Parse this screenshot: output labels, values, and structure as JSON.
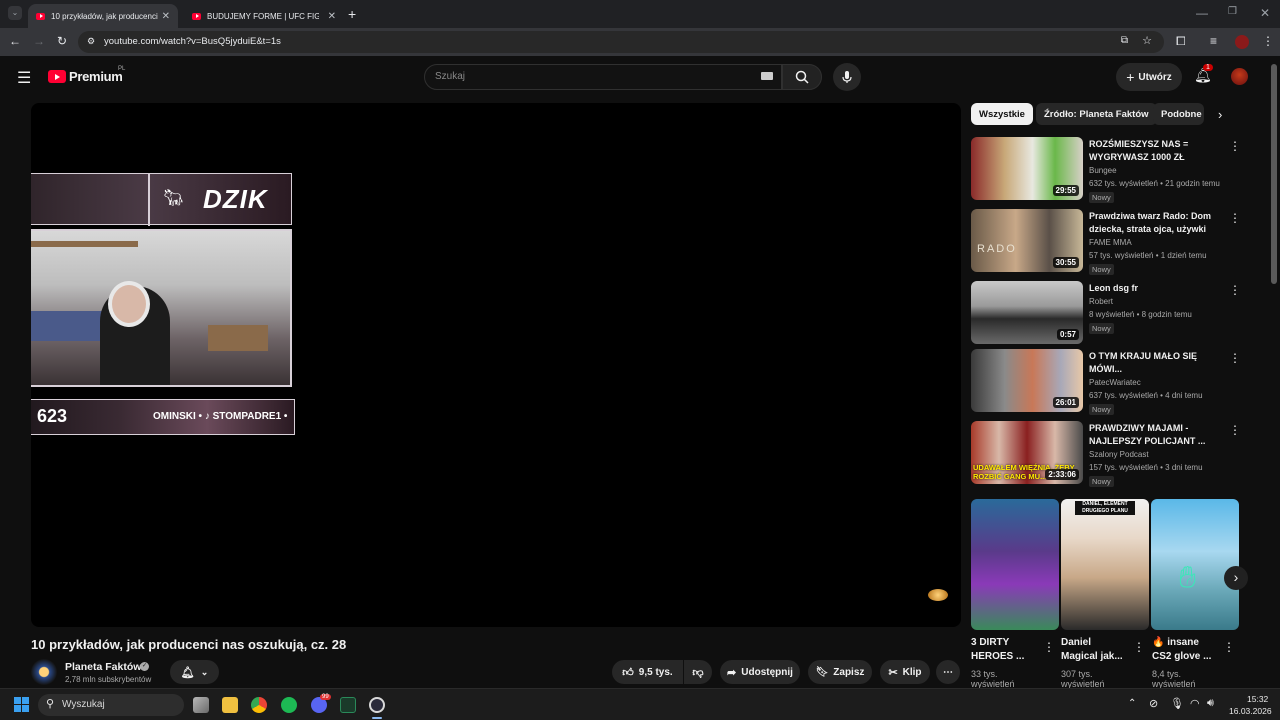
{
  "browser": {
    "tabs": [
      {
        "label": "10 przykładów, jak producenci"
      },
      {
        "label": "BUDUJEMY FORME | UFC FIGHT"
      }
    ],
    "url": "youtube.com/watch?v=BusQ5jyduiE&t=1s"
  },
  "header": {
    "logo": "Premium",
    "logo_badge": "PL",
    "search_placeholder": "Szukaj",
    "create_label": "Utwórz",
    "notif_count": "1"
  },
  "video": {
    "title": "10 przykładów, jak producenci nas oszukują, cz. 28",
    "channel": "Planeta Faktów",
    "subscribers": "2,78 mln subskrybentów",
    "likes": "9,5 tys.",
    "share_label": "Udostępnij",
    "save_label": "Zapisz",
    "clip_label": "Klip"
  },
  "overlay": {
    "brand": "DZIK",
    "counter": "623",
    "ticker": "OMINSKI • ♪ STOMPADRE1 •"
  },
  "chips": [
    "Wszystkie",
    "Źródło: Planeta Faktów",
    "Podobne"
  ],
  "related": [
    {
      "title": "ROZŚMIESZYSZ NAS = WYGRYWASZ 1000 ZŁ",
      "channel": "Bungee",
      "meta": "632 tys. wyświetleń • 21 godzin temu",
      "badge": "Nowy",
      "duration": "29:55"
    },
    {
      "title": "Prawdziwa twarz Rado: Dom dziecka, strata ojca, używki",
      "channel": "FAME MMA",
      "meta": "57 tys. wyświetleń • 1 dzień temu",
      "badge": "Nowy",
      "duration": "30:55"
    },
    {
      "title": "Leon dsg fr",
      "channel": "Robert",
      "meta": "8 wyświetleń • 8 godzin temu",
      "badge": "Nowy",
      "duration": "0:57"
    },
    {
      "title": "O TYM KRAJU MAŁO SIĘ MÓWI...",
      "channel": "PatecWariatec",
      "meta": "637 tys. wyświetleń • 4 dni temu",
      "badge": "Nowy",
      "duration": "26:01"
    },
    {
      "title": "PRAWDZIWY MAJAMI - NAJLEPSZY POLICJANT ...",
      "channel": "Szalony Podcast",
      "meta": "157 tys. wyświetleń • 3 dni temu",
      "badge": "Nowy",
      "duration": "2:33:06"
    }
  ],
  "thumb_texts": {
    "rado": "RADO",
    "gang": "UDAWAŁEM WIĘŹNIA, ŻEBY ROZBIĆ GANG MU..."
  },
  "shorts": [
    {
      "title": "3 DIRTY HEROES ...",
      "views": "33 tys. wyświetleń"
    },
    {
      "title": "Daniel Magical jak...",
      "views": "307 tys. wyświetleń",
      "thumb_text": "DANIEL, ELEMENT DRUGIEGO PLANU"
    },
    {
      "title": "🔥 insane CS2 glove ...",
      "views": "8,4 tys. wyświetleń"
    }
  ],
  "taskbar": {
    "search": "Wyszukaj",
    "time": "15:32",
    "date": "16.03.2026",
    "discord_badge": "99"
  }
}
